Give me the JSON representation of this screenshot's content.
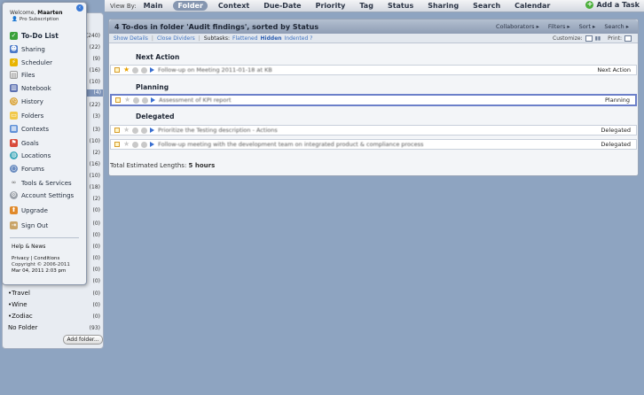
{
  "topbar": {
    "view_by": "View By:",
    "nav": [
      "Main",
      "Folder",
      "Context",
      "Due-Date",
      "Priority",
      "Tag",
      "Status",
      "Sharing",
      "Search",
      "Calendar"
    ],
    "active": "Folder",
    "add_task": "Add a Task"
  },
  "popup": {
    "welcome": "Welcome,",
    "user": "Maarten",
    "subscription": "Pro Subscription",
    "items": [
      "To-Do List",
      "Sharing",
      "Scheduler",
      "Files",
      "Notebook",
      "History",
      "Folders",
      "Contexts",
      "Goals",
      "Locations",
      "Forums",
      "Tools & Services",
      "Account Settings",
      "Upgrade",
      "Sign Out"
    ],
    "help": "Help & News",
    "privacy": "Privacy | Conditions",
    "copyright": "Copyright © 2006-2011",
    "date": "Mar 04, 2011 2:03 pm"
  },
  "folders": {
    "counts": [
      "(240)",
      "(22)",
      "(9)",
      "(16)",
      "(10)",
      "(4)",
      "(22)",
      "(3)",
      "(3)",
      "(10)",
      "(2)",
      "(16)",
      "(10)",
      "(18)",
      "(2)",
      "(0)",
      "(0)",
      "(0)",
      "(0)",
      "(0)",
      "(0)",
      "(0)"
    ],
    "rows": [
      {
        "label": "•Travel",
        "count": "(0)"
      },
      {
        "label": "•Wine",
        "count": "(0)"
      },
      {
        "label": "•Zodiac",
        "count": "(0)"
      },
      {
        "label": "No Folder",
        "count": "(93)"
      }
    ],
    "add_folder": "Add folder..."
  },
  "main": {
    "title": "4 To-dos in folder 'Audit findings', sorted by Status",
    "opts": [
      "Collaborators ▸",
      "Filters ▸",
      "Sort ▸",
      "Search ▸"
    ],
    "show_details": "Show Details",
    "close_dividers": "Close Dividers",
    "subtasks": "Subtasks:",
    "flattened": "Flattened",
    "hidden": "Hidden",
    "indented": "Indented",
    "customize": "Customize:",
    "print": "Print:",
    "groups": [
      "Next Action",
      "Planning",
      "Delegated"
    ],
    "tasks": [
      {
        "title": "Follow-up on Meeting 2011-01-18 at KB",
        "status": "Next Action"
      },
      {
        "title": "Assessment of KPI report",
        "status": "Planning"
      },
      {
        "title": "Prioritize the Testing description - Actions",
        "status": "Delegated"
      },
      {
        "title": "Follow-up meeting with the development team on integrated product & compliance process",
        "status": "Delegated"
      }
    ],
    "total_label": "Total Estimated Lengths:",
    "total_value": "5 hours"
  }
}
